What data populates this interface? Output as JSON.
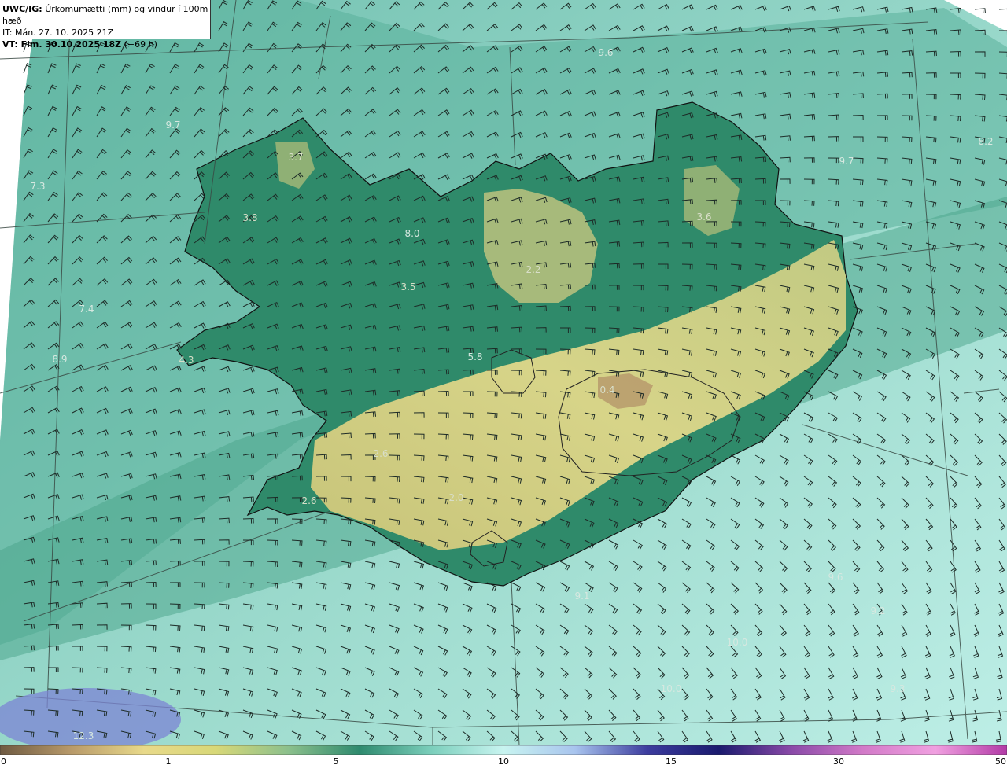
{
  "header": {
    "prefix": "UWC/IG:",
    "title": "Úrkomumætti (mm) og vindur í 100m hæð",
    "it_line": "IT: Mán. 27. 10. 2025 21Z",
    "vt_prefix": "VT: Fim. 30.10.2025 18Z",
    "vt_suffix": "(+69 h)"
  },
  "value_labels": [
    "9.6",
    "9.7",
    "7.3",
    "3.7",
    "3.8",
    "8.0",
    "3.5",
    "2.2",
    "3.6",
    "8.2",
    "9.7",
    "7.4",
    "8.9",
    "4.3",
    "5.8",
    "0.4",
    "2.6",
    "2.6",
    "2.0",
    "9.1",
    "9.6",
    "9.2",
    "10.0",
    "10.0",
    "9.3",
    "12.3"
  ],
  "colorbar": {
    "ticks": [
      "0",
      "1",
      "5",
      "10",
      "15",
      "30",
      "50"
    ],
    "colors": [
      "#6e5a42",
      "#b89a6a",
      "#e8d98a",
      "#d8d878",
      "#8cc08c",
      "#2e8a6e",
      "#7ccfbc",
      "#c8f4f0",
      "#a8c4ee",
      "#3c3c9e",
      "#1a1a6e",
      "#8a4aa8",
      "#d27ac8",
      "#f0a0e0",
      "#b23aa6"
    ]
  },
  "colors": {
    "land": "#2f8a6a",
    "precip_band": "#d8d27e",
    "ocean": "#8fd2c4",
    "coast": "#111111"
  }
}
